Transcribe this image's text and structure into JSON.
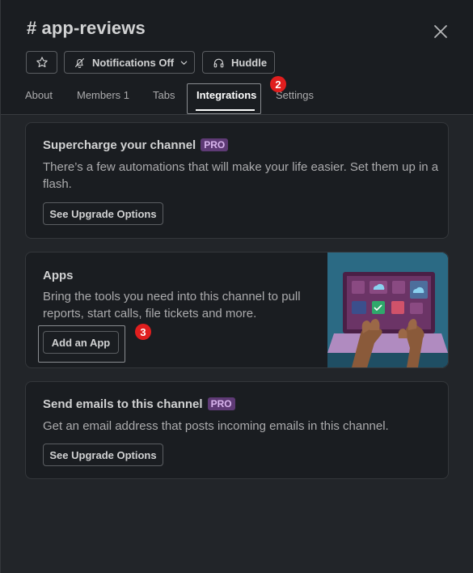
{
  "header": {
    "title": "# app-reviews",
    "star_icon": "star-icon",
    "notifications_label": "Notifications Off",
    "huddle_label": "Huddle"
  },
  "tabs": [
    {
      "label": "About"
    },
    {
      "label": "Members 1"
    },
    {
      "label": "Tabs"
    },
    {
      "label": "Integrations",
      "active": true
    },
    {
      "label": "Settings"
    }
  ],
  "annotations": {
    "step_integrations": "2",
    "step_add_app": "3"
  },
  "cards": {
    "supercharge": {
      "title": "Supercharge your channel",
      "badge": "PRO",
      "description": "There’s a few automations that will make your life easier. Set them up in a flash.",
      "button": "See Upgrade Options"
    },
    "apps": {
      "title": "Apps",
      "description": "Bring the tools you need into this channel to pull reports, start calls, file tickets and more.",
      "button": "Add an App"
    },
    "emails": {
      "title": "Send emails to this channel",
      "badge": "PRO",
      "description": "Get an email address that posts incoming emails in this channel.",
      "button": "See Upgrade Options"
    }
  },
  "colors": {
    "background": "#1a1d21",
    "pro_badge": "#5e3a75",
    "step_badge": "#e01e1e",
    "illustration_bg": "#2b6a84"
  }
}
